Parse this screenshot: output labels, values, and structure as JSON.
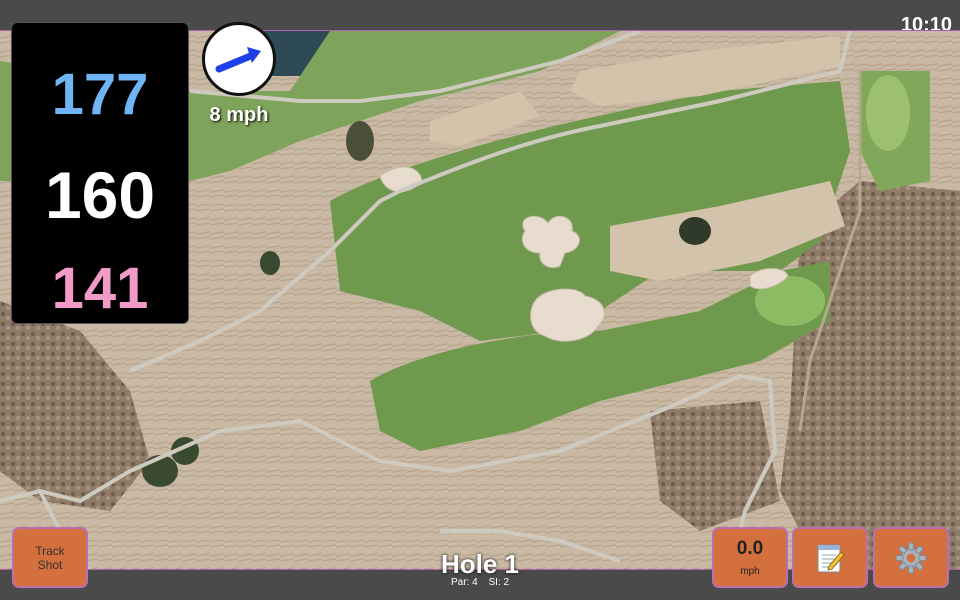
{
  "clock": "10:10",
  "yardages": {
    "back": "177",
    "middle": "160",
    "front": "141",
    "back_color": "#6fb5f5",
    "middle_color": "#ffffff",
    "front_color": "#f29ac8"
  },
  "wind": {
    "speed_label": "8 mph",
    "arrow_icon": "arrow-right-icon",
    "arrow_color": "#1f3fe8"
  },
  "buttons": {
    "track_shot_line1": "Track",
    "track_shot_line2": "Shot",
    "speed_value": "0.0",
    "speed_unit": "mph",
    "notes_icon": "notepad-icon",
    "settings_icon": "gear-icon",
    "button_color": "#d4703e"
  },
  "hole": {
    "title": "Hole 1",
    "par": "Par: 4",
    "si": "SI: 2"
  }
}
